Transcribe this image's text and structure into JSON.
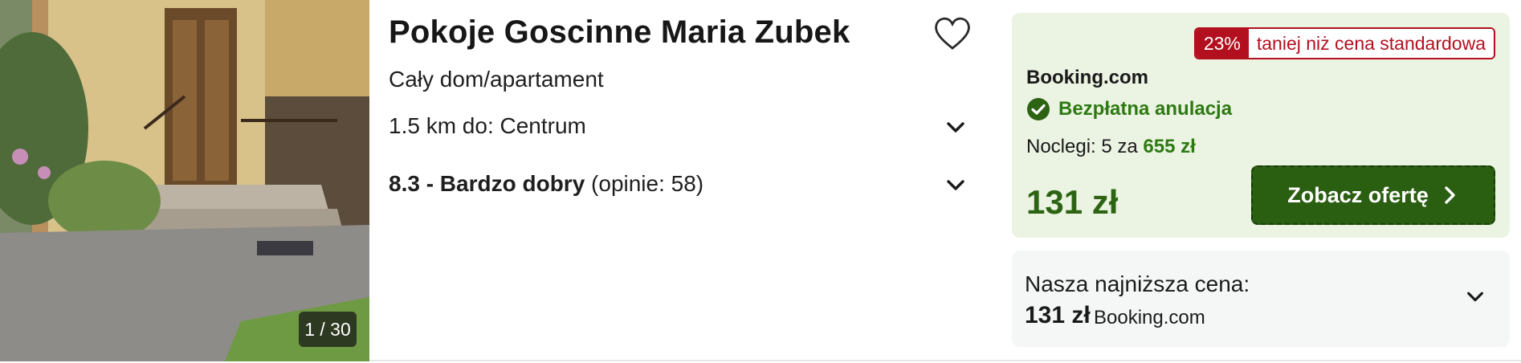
{
  "listing": {
    "title": "Pokoje Goscinne Maria Zubek",
    "type": "Cały dom/apartament",
    "distance": "1.5 km do: Centrum",
    "rating_score": "8.3 - Bardzo dobry",
    "rating_reviews": "(opinie: 58)",
    "photo_counter": "1 / 30"
  },
  "offer": {
    "discount_pct": "23%",
    "discount_text": "taniej niż cena standardowa",
    "provider": "Booking.com",
    "cancellation": "Bezpłatna anulacja",
    "nights_prefix": "Noclegi: 5 za",
    "nights_total": "655 zł",
    "price": "131 zł",
    "cta_label": "Zobacz ofertę"
  },
  "lowest": {
    "label": "Nasza najniższa cena:",
    "price": "131 zł",
    "provider": "Booking.com"
  },
  "colors": {
    "accent_green": "#2d7a12",
    "cta_green": "#2a5f12",
    "discount_red": "#b3101f",
    "offer_bg": "#ebf3e2"
  },
  "icons": [
    "heart-icon",
    "chevron-down-icon",
    "check-circle-icon",
    "chevron-right-icon"
  ]
}
